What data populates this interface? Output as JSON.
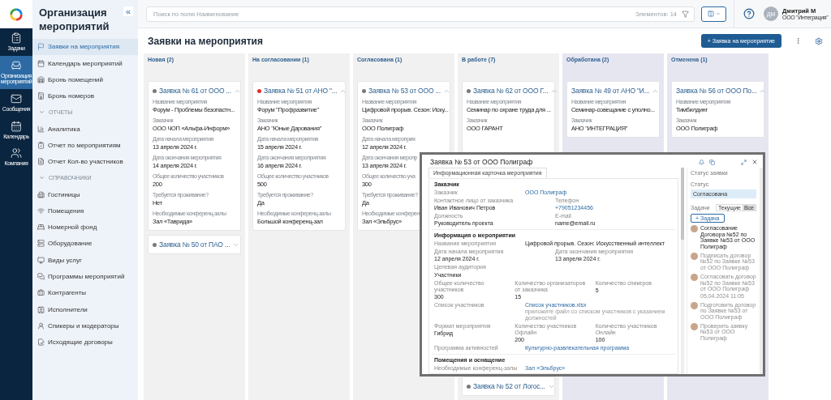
{
  "rail": {
    "items": [
      {
        "label": "Задачи",
        "selected": false
      },
      {
        "label": "Организация мероприятий",
        "selected": true
      },
      {
        "label": "Сообщения",
        "selected": false
      },
      {
        "label": "Календарь",
        "selected": false
      },
      {
        "label": "Компания",
        "selected": false
      }
    ]
  },
  "sidebar": {
    "title": "Организация мероприятий",
    "collapse": "«",
    "items": [
      {
        "label": "Заявки на мероприятия",
        "selected": true
      },
      {
        "label": "Календарь мероприятий",
        "selected": false
      },
      {
        "label": "Бронь помещений",
        "selected": false
      },
      {
        "label": "Бронь номеров",
        "selected": false
      }
    ],
    "sections": [
      {
        "title": "ОТЧЕТЫ",
        "expanded": true,
        "items": [
          {
            "label": "Аналитика",
            "selected": false
          },
          {
            "label": "Отчет по мероприятиям",
            "selected": false
          },
          {
            "label": "Отчет Кол-во участников",
            "selected": false
          }
        ]
      },
      {
        "title": "СПРАВОЧНИКИ",
        "expanded": true,
        "items": [
          {
            "label": "Гостиницы",
            "selected": false
          },
          {
            "label": "Помещения",
            "selected": false
          },
          {
            "label": "Номерной фонд",
            "selected": false
          },
          {
            "label": "Оборудование",
            "selected": false
          },
          {
            "label": "Виды услуг",
            "selected": false
          },
          {
            "label": "Программы мероприятий",
            "selected": false
          },
          {
            "label": "Контрагенты",
            "selected": false
          },
          {
            "label": "Исполнители",
            "selected": false
          },
          {
            "label": "Спикеры и модераторы",
            "selected": false
          },
          {
            "label": "Исходящие договоры",
            "selected": false
          }
        ]
      }
    ]
  },
  "topbar": {
    "search": {
      "placeholder": "Поиск по полю Наименование"
    },
    "count": "Элементов: 14",
    "user": {
      "initials": "ДМ",
      "name": "Дмитрий М",
      "org": "ООО \"Интеграция\""
    }
  },
  "page": {
    "title": "Заявки на мероприятия",
    "add_button": "+ Заявка на мероприятие"
  },
  "board": {
    "columns": [
      {
        "title": "Новая (2)",
        "kind": "open",
        "cards": [
          {
            "title": "Заявка № 61 от ООО ...",
            "color": "#7a7a7a",
            "expanded": true,
            "fields": [
              {
                "label": "Название мероприятия",
                "value": "Форум - Проблемы безопастн..."
              },
              {
                "label": "Заказчик",
                "value": "ООО ЧОП «Альфа-Информ»"
              },
              {
                "label": "Дата начала мероприятия",
                "value": "13 апреля 2024 г."
              },
              {
                "label": "Дата окончания мероприятия",
                "value": "14 апреля 2024 г."
              },
              {
                "label": "Общее количество участников",
                "value": "200"
              },
              {
                "label": "Требуется проживание?",
                "value": "Нет"
              },
              {
                "label": "Необходимые конференц-залы",
                "value": "Зал «Таврида»"
              }
            ]
          },
          {
            "title": "Заявка № 50 от ПАО ...",
            "color": "#7a7a7a",
            "expanded": false
          }
        ]
      },
      {
        "title": "На согласовании (1)",
        "kind": "open",
        "cards": [
          {
            "title": "Заявка № 51 от АНО \"...",
            "color": "#e0302b",
            "expanded": true,
            "fields": [
              {
                "label": "Название мероприятия",
                "value": "Форум \"Профразвитие\""
              },
              {
                "label": "Заказчик",
                "value": "АНО \"Юные Дарования\""
              },
              {
                "label": "Дата начала мероприятия",
                "value": "15 апреля 2024 г."
              },
              {
                "label": "Дата окончания мероприятия",
                "value": "16 апреля 2024 г."
              },
              {
                "label": "Общее количество участников",
                "value": "500"
              },
              {
                "label": "Требуется проживание?",
                "value": "Да"
              },
              {
                "label": "Необходимые конференц-залы",
                "value": "Большой конференц-зал"
              }
            ]
          }
        ]
      },
      {
        "title": "Согласована (1)",
        "kind": "open",
        "cards": [
          {
            "title": "Заявка № 53 от ООО ...",
            "color": "#7a7a7a",
            "expanded": true,
            "fields": [
              {
                "label": "Название мероприятия",
                "value": "Цифровой прорыв. Сезон: Иску..."
              },
              {
                "label": "Заказчик",
                "value": "ООО Полиграф"
              },
              {
                "label": "Дата начала мероприя",
                "value": "12 апреля 2024 г."
              },
              {
                "label": "Дата окончания меропр",
                "value": "13 апреля 2024 г."
              },
              {
                "label": "Общее количество уча",
                "value": "300"
              },
              {
                "label": "Требуется проживание?",
                "value": "Да"
              },
              {
                "label": "Необходимые конферен",
                "value": "Зал «Эльбрус»"
              }
            ]
          }
        ]
      },
      {
        "title": "В работе (7)",
        "kind": "open",
        "cards": [
          {
            "title": "Заявка № 62 от ООО Г...",
            "color": "#7a7a7a",
            "expanded": true,
            "fields": [
              {
                "label": "Название мероприятия",
                "value": "Семинар по охране труда для ..."
              },
              {
                "label": "Заказчик",
                "value": "ООО ГАРАНТ"
              }
            ]
          },
          {
            "title": "Заявка № 52 от Логос...",
            "color": "#7a7a7a",
            "expanded": false
          }
        ]
      },
      {
        "title": "Обработана (2)",
        "kind": "closed",
        "cards": [
          {
            "title": "Заявка № 49 от АНО \"И...",
            "expanded": true,
            "fields": [
              {
                "label": "Название мероприятия",
                "value": "Семинар-совещание с уполно..."
              },
              {
                "label": "Заказчик",
                "value": "АНО \"ИНТЕГРАЦИЯ\""
              }
            ]
          }
        ]
      },
      {
        "title": "Отменена (1)",
        "kind": "closed",
        "cards": [
          {
            "title": "Заявка № 56 от ООО По...",
            "expanded": true,
            "fields": [
              {
                "label": "Название мероприятия",
                "value": "Тимбилдинг"
              },
              {
                "label": "Заказчик",
                "value": "ООО Полиграф"
              }
            ]
          }
        ]
      }
    ]
  },
  "detail": {
    "title": "Заявка № 53 от ООО Полиграф",
    "tabs": [
      {
        "label": "Информационная карточка мероприятия",
        "selected": true
      }
    ],
    "sections": [
      {
        "title": "Заказчик",
        "rows": [
          {
            "kind": "inline",
            "label": "Заказчик",
            "value": "ООО Полиграф",
            "link": true
          },
          {
            "kind": "grid",
            "cells": [
              {
                "label": "Контактное лицо от заказчика",
                "value": "Иван Иванович Петров",
                "link": false
              },
              {
                "label": "Телефон",
                "value": "+79051234456",
                "link": true
              }
            ]
          },
          {
            "kind": "grid",
            "cells": [
              {
                "label": "Должность",
                "value": "Руководитель проекта",
                "link": false
              },
              {
                "label": "E-mail",
                "value": "name@email.ru",
                "link": false
              }
            ]
          }
        ]
      },
      {
        "title": "Информация о мероприятии",
        "rows": [
          {
            "kind": "inline",
            "label": "Название мероприятия",
            "value": "Цифровой прорыв. Сезон: Искусственный интеллект",
            "link": false
          },
          {
            "kind": "grid",
            "cells": [
              {
                "label": "Дата начала мероприятия",
                "value": "12 апреля 2024 г.",
                "link": false
              },
              {
                "label": "Дата окончания мероприятия",
                "value": "13 апреля 2024 г.",
                "link": false
              }
            ]
          },
          {
            "kind": "grid",
            "cells": [
              {
                "label": "Целевая аудитория",
                "value": "Участники",
                "link": false
              }
            ]
          },
          {
            "kind": "grid",
            "cells": [
              {
                "label": "Общее количество участников",
                "value": "300",
                "link": false
              },
              {
                "label": "Количество организаторов от заказчика",
                "value": "15",
                "link": false
              },
              {
                "label": "Количество спикеров",
                "value": "5",
                "link": false
              }
            ]
          },
          {
            "kind": "inline",
            "label": "Список участников",
            "value": "Список участников.xlsx",
            "link": true,
            "hint": "приложите файл со списком участников с указанием должностей"
          },
          {
            "kind": "grid",
            "cells": [
              {
                "label": "Формат мероприятия",
                "value": "Гибрид",
                "link": false
              },
              {
                "label": "Количество участников Офлайн",
                "value": "200",
                "link": false
              },
              {
                "label": "Количество участников Онлайн",
                "value": "100",
                "link": false
              }
            ]
          },
          {
            "kind": "inline",
            "label": "Программа активностей",
            "value": "Культурно-развлекательная программа",
            "link": true
          }
        ]
      },
      {
        "title": "Помещения и оснащение",
        "rows": [
          {
            "kind": "inline",
            "label": "Необходимые конференц-залы",
            "value": "Зал «Эльбрус»",
            "link": true
          }
        ]
      }
    ],
    "side": {
      "group": "Статус заявки",
      "status_label": "Статус",
      "status": "Согласована",
      "tasks_label": "Задачи",
      "filters": [
        {
          "label": "Текущие",
          "selected": false
        },
        {
          "label": "Все",
          "selected": true
        }
      ],
      "add": "+ Задача",
      "tasks": [
        {
          "text": "Согласование Договора №52 по Заявке №53 от ООО Полиграф",
          "done": false
        },
        {
          "text": "Подписать договор №52 по Заявке №53 от ООО Полиграф",
          "done": true
        },
        {
          "text": "Согласовать договор №52 по Заявке №53 от ООО Полиграф",
          "done": true,
          "date": "05.04.2024 11:05"
        },
        {
          "text": "Подготовить договор по Заявке №53 от ООО Полиграф",
          "done": true
        },
        {
          "text": "Проверить заявку №53 от ООО Полиграф",
          "done": true
        }
      ]
    }
  }
}
